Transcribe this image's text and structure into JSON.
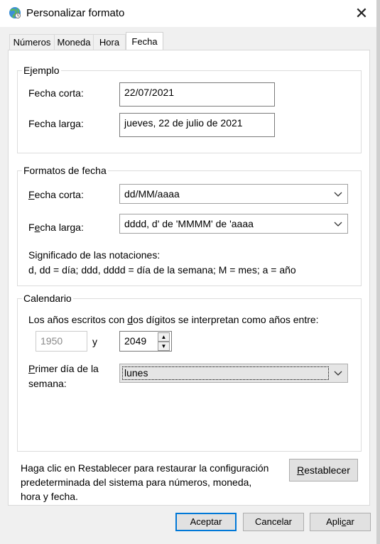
{
  "window": {
    "title": "Personalizar formato",
    "close_glyph": "✕"
  },
  "tabs": [
    {
      "label": "Números"
    },
    {
      "label": "Moneda"
    },
    {
      "label": "Hora"
    },
    {
      "label": "Fecha"
    }
  ],
  "ejemplo": {
    "legend": "Ejemplo",
    "short_label": "Fecha corta:",
    "short_value": "22/07/2021",
    "long_label": "Fecha larga:",
    "long_value": "jueves, 22 de julio de 2021"
  },
  "formatos": {
    "legend": "Formatos de fecha",
    "short_label_a": "F",
    "short_label_u": "e",
    "short_label_b": "cha corta:",
    "short_value": "dd/MM/aaaa",
    "long_label_a": "F",
    "long_label_u": "e",
    "long_label_b": "cha larga:",
    "long_value": "dddd, d' de 'MMMM' de 'aaaa",
    "notes_title": "Significado de las notaciones:",
    "notes_text": "d, dd = día;  ddd, dddd = día de la semana; M = mes; a = año"
  },
  "calendario": {
    "legend": "Calendario",
    "years_text_a": "Los años escritos con ",
    "years_text_u": "d",
    "years_text_b": "os dígitos se interpretan como años entre:",
    "year_from": "1950",
    "year_and": "y",
    "year_to": "2049",
    "firstday_label_a": "P",
    "firstday_label_u": "r",
    "firstday_label_b": "imer día de la",
    "firstday_label_c": "semana:",
    "firstday_value": "lunes"
  },
  "footer": {
    "reset_text_1": "Haga clic en Restablecer para restaurar la configuración",
    "reset_text_2": "predeterminada del sistema para números, moneda,",
    "reset_text_3": "hora y fecha.",
    "reset_button_u": "R",
    "reset_button_rest": "establecer"
  },
  "buttons": {
    "ok": "Aceptar",
    "cancel": "Cancelar",
    "apply_a": "Apli",
    "apply_u": "c",
    "apply_b": "ar"
  },
  "icons": {
    "app": "globe-icon",
    "close": "close-icon",
    "dropdown": "chevron-down-icon"
  },
  "colors": {
    "accent": "#0078d7",
    "window_bg": "#f0f0f0",
    "panel_bg": "#ffffff"
  }
}
